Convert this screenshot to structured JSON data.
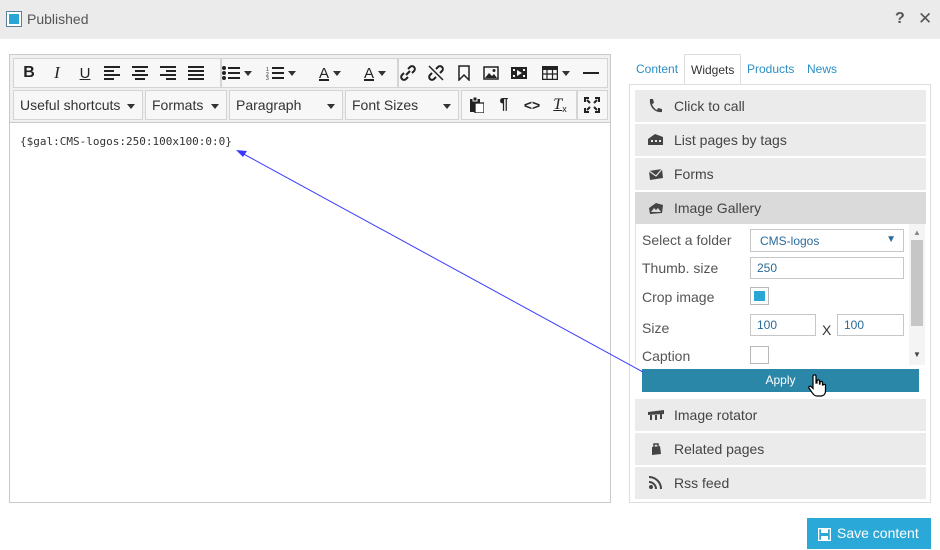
{
  "titlebar": {
    "published_label": "Published",
    "help_icon": "?",
    "close_icon": "✕"
  },
  "editor": {
    "toolbar_row1_icons": [
      "bold-icon",
      "italic-icon",
      "underline-icon",
      "align-left-icon",
      "align-center-icon",
      "align-right-icon",
      "align-justify-icon",
      "bullet-list-icon",
      "numbered-list-icon",
      "text-color-icon",
      "background-color-icon",
      "link-icon",
      "unlink-icon",
      "bookmark-icon",
      "image-icon",
      "media-icon",
      "table-icon",
      "horizontal-rule-icon"
    ],
    "dropdowns": {
      "shortcuts": "Useful shortcuts",
      "formats": "Formats",
      "paragraph": "Paragraph",
      "font_sizes": "Font Sizes"
    },
    "toolbar_row2_icons": [
      "paste-icon",
      "paragraph-mark-icon",
      "code-icon",
      "clear-format-icon",
      "fullscreen-icon"
    ],
    "content_text": "{$gal:CMS-logos:250:100x100:0:0}"
  },
  "tabs": {
    "content": "Content",
    "widgets": "Widgets",
    "products": "Products",
    "news": "News"
  },
  "widgets": {
    "click_to_call": "Click to call",
    "list_pages_by_tags": "List pages by tags",
    "forms": "Forms",
    "image_gallery": "Image Gallery",
    "image_rotator": "Image rotator",
    "related_pages": "Related pages",
    "rss_feed": "Rss feed"
  },
  "gallery_form": {
    "folder_label": "Select a folder",
    "folder_value": "CMS-logos",
    "thumb_label": "Thumb. size",
    "thumb_value": "250",
    "crop_label": "Crop image",
    "crop_checked": true,
    "size_label": "Size",
    "size_width": "100",
    "size_sep": "X",
    "size_height": "100",
    "caption_label": "Caption",
    "caption_checked": false,
    "apply_label": "Apply"
  },
  "footer": {
    "save_label": "Save content"
  },
  "colors": {
    "accent": "#2aa6d4",
    "apply_bg": "#2a87a8",
    "link": "#2a8fc4",
    "arrow": "#3a3aff"
  }
}
